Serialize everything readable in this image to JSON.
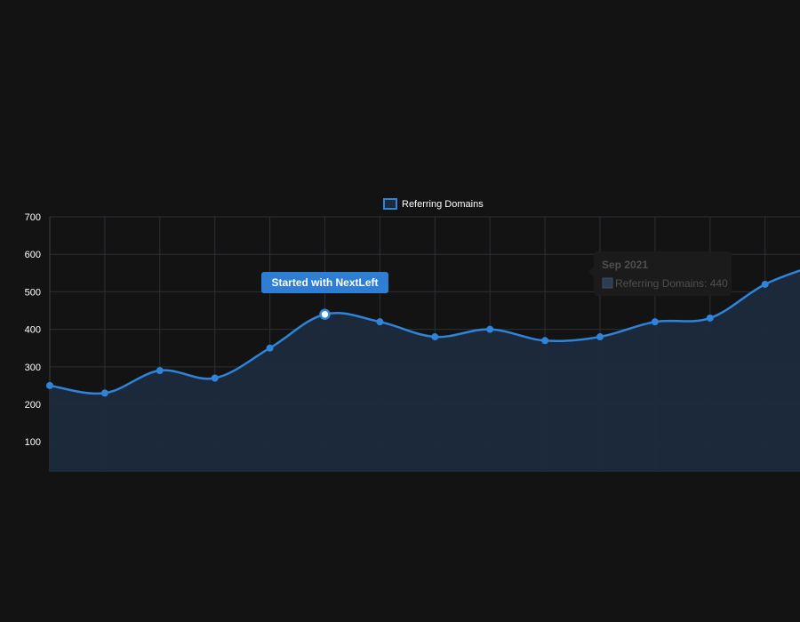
{
  "chart_data": {
    "type": "line",
    "area_fill": true,
    "smooth": true,
    "grid": true,
    "legend_position": "top-center",
    "series": [
      {
        "name": "Referring Domains",
        "values": [
          250,
          230,
          290,
          270,
          350,
          440,
          420,
          380,
          400,
          370,
          380,
          420,
          430,
          520,
          575
        ]
      }
    ],
    "y_ticks": [
      100,
      200,
      300,
      400,
      500,
      600,
      700
    ],
    "ylim": [
      20,
      700
    ],
    "highlight_index": 5,
    "annotation": {
      "label": "Started with NextLeft"
    },
    "tooltip": {
      "title": "Sep 2021",
      "line": "Referring Domains: 440"
    },
    "colors": {
      "line": "#2e84d8",
      "fill": "#1b2a3d",
      "grid": "#2b2f35",
      "text": "#ffffff",
      "annotation_bg": "#2e7fd4",
      "tooltip_bg": "#1b1b1b",
      "tooltip_text": "#4f4f4f"
    }
  }
}
